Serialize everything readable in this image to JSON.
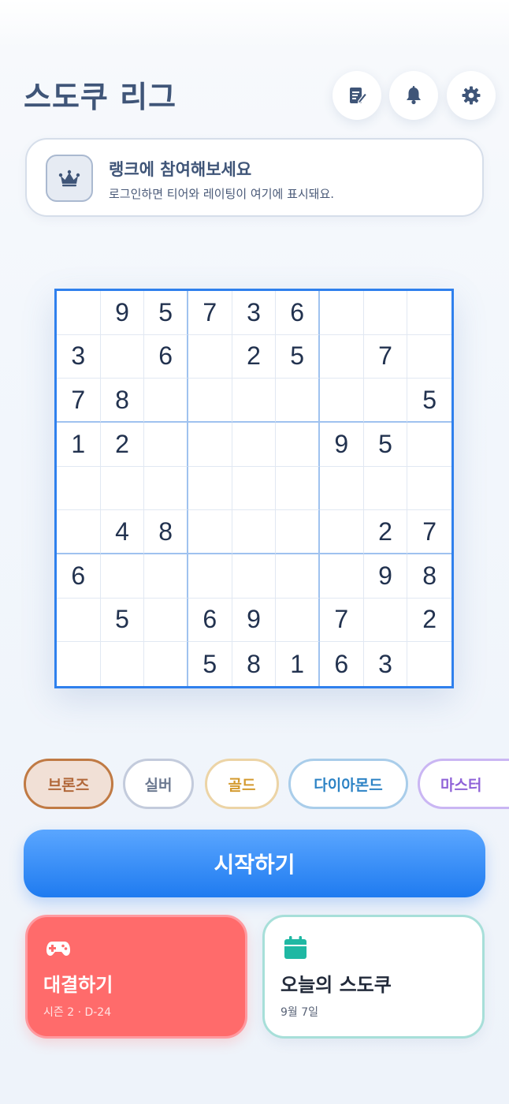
{
  "header": {
    "title": "스도쿠 리그",
    "icons": [
      "notes-icon",
      "bell-icon",
      "gear-icon"
    ]
  },
  "rank_card": {
    "icon": "crown-icon",
    "title": "랭크에 참여해보세요",
    "subtitle": "로그인하면 티어와 레이팅이 여기에 표시돼요."
  },
  "board": {
    "rows": [
      [
        "",
        "9",
        "5",
        "7",
        "3",
        "6",
        "",
        "",
        ""
      ],
      [
        "3",
        "",
        "6",
        "",
        "2",
        "5",
        "",
        "7",
        ""
      ],
      [
        "7",
        "8",
        "",
        "",
        "",
        "",
        "",
        "",
        "5"
      ],
      [
        "1",
        "2",
        "",
        "",
        "",
        "",
        "9",
        "5",
        ""
      ],
      [
        "",
        "",
        "",
        "",
        "",
        "",
        "",
        "",
        ""
      ],
      [
        "",
        "4",
        "8",
        "",
        "",
        "",
        "",
        "2",
        "7"
      ],
      [
        "6",
        "",
        "",
        "",
        "",
        "",
        "",
        "9",
        "8"
      ],
      [
        "",
        "5",
        "",
        "6",
        "9",
        "",
        "7",
        "",
        "2"
      ],
      [
        "",
        "",
        "",
        "5",
        "8",
        "1",
        "6",
        "3",
        ""
      ]
    ]
  },
  "tiers": {
    "bronze": "브론즈",
    "silver": "실버",
    "gold": "골드",
    "diamond": "다이아몬드",
    "master": "마스터"
  },
  "start_button": {
    "label": "시작하기"
  },
  "cards": {
    "battle": {
      "icon": "gamepad-icon",
      "title": "대결하기",
      "subtitle": "시즌 2 · D-24"
    },
    "daily": {
      "icon": "calendar-icon",
      "title": "오늘의 스도쿠",
      "subtitle": "9월 7일"
    }
  },
  "colors": {
    "accent": "#2f80ed",
    "title": "#3f5578",
    "battle": "#ff6b6b",
    "daily_icon": "#1fb8a3"
  }
}
